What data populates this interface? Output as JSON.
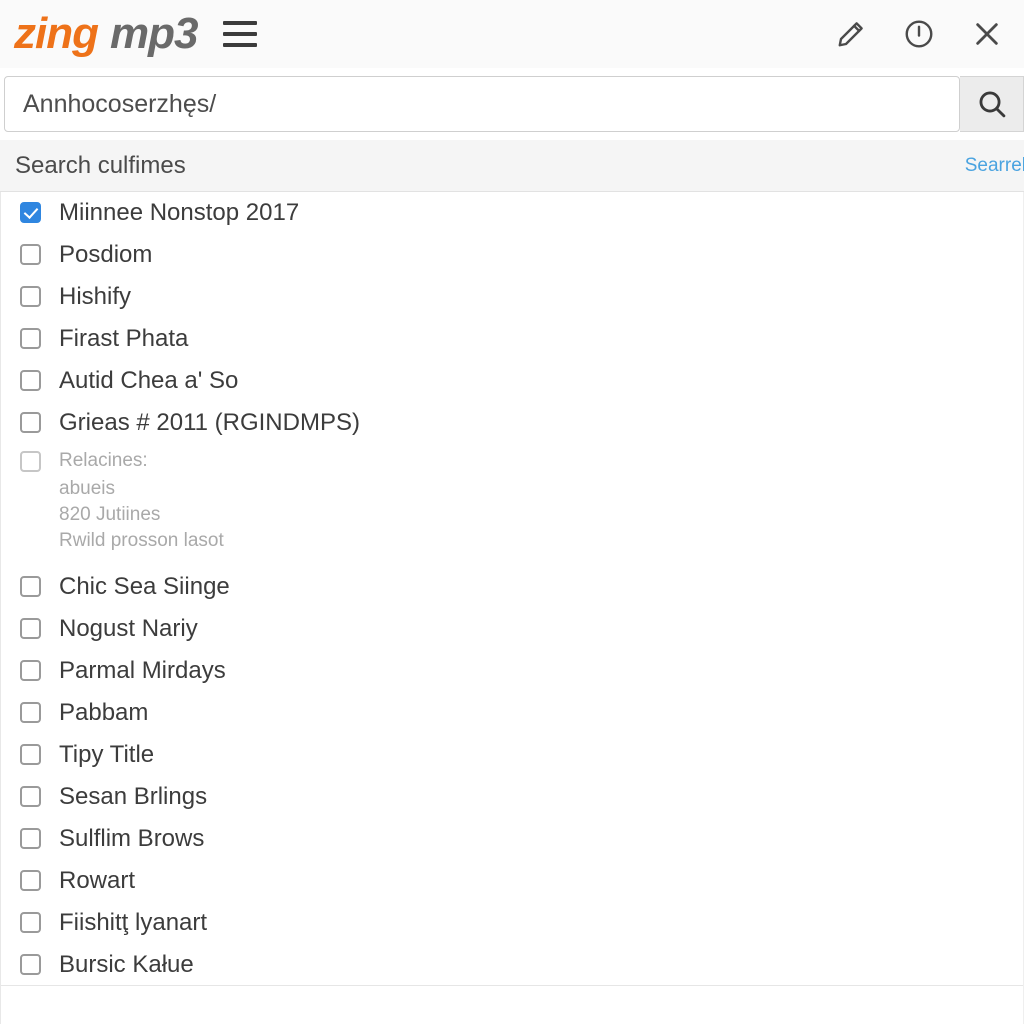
{
  "header": {
    "brand_primary": "zing",
    "brand_secondary": "mp3",
    "menu_icon": "hamburger-menu-icon",
    "icons": [
      {
        "name": "edit-pencil-icon",
        "label": "Edit"
      },
      {
        "name": "power-info-icon",
        "label": "Info"
      },
      {
        "name": "close-x-icon",
        "label": "Close"
      }
    ]
  },
  "search": {
    "value": "Annhocoserzhęs/",
    "placeholder": "Annhocoserzhęs/",
    "button_icon": "search-magnifier-icon"
  },
  "section": {
    "title": "Search culfimes",
    "action_label": "Searrel"
  },
  "list": {
    "items": [
      {
        "label": "Miinnee Nonstop 2017",
        "checked": true,
        "dim": false
      },
      {
        "label": "Posdiom",
        "checked": false,
        "dim": false
      },
      {
        "label": "Hishify",
        "checked": false,
        "dim": false
      },
      {
        "label": "Firast Phata",
        "checked": false,
        "dim": false
      },
      {
        "label": "Autid Chea a' So",
        "checked": false,
        "dim": false
      },
      {
        "label": "Grieas # 2011 (RGINDMPS)",
        "checked": false,
        "dim": false
      },
      {
        "label": "Relacines:",
        "checked": false,
        "dim": true,
        "sublines": [
          "abueis",
          "820 Jutiines",
          "Rwild prosson lasot"
        ]
      },
      {
        "label": "Chic Sea Siinge",
        "checked": false,
        "dim": false
      },
      {
        "label": "Nogust Nariy",
        "checked": false,
        "dim": false
      },
      {
        "label": "Parmal Mirdays",
        "checked": false,
        "dim": false
      },
      {
        "label": "Pabbam",
        "checked": false,
        "dim": false
      },
      {
        "label": "Tipy Title",
        "checked": false,
        "dim": false
      },
      {
        "label": "Sesan Brlings",
        "checked": false,
        "dim": false
      },
      {
        "label": "Sulflim Brows",
        "checked": false,
        "dim": false
      },
      {
        "label": "Rowart",
        "checked": false,
        "dim": false
      },
      {
        "label": "Fiishitţ lyanart",
        "checked": false,
        "dim": false
      },
      {
        "label": "Bursic Kałue",
        "checked": false,
        "dim": false
      }
    ]
  },
  "colors": {
    "brand_orange": "#ee7219",
    "brand_gray": "#6a6a6a",
    "accent_blue": "#2f86e0",
    "link_blue": "#4aa3e0",
    "band_bg": "#f5f5f5"
  }
}
